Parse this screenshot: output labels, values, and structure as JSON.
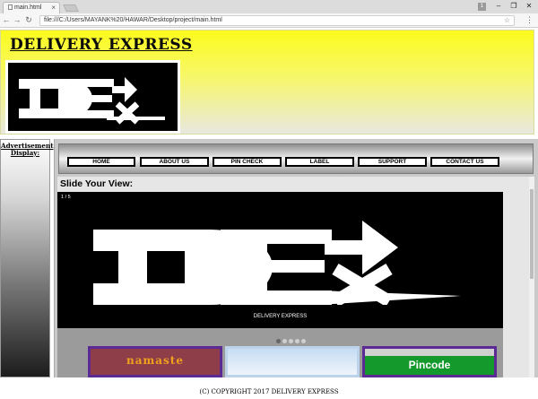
{
  "browser": {
    "tab_title": "main.html",
    "address": "file:///C:/Users/MAYANK%20/HAWAR/Desktop/project/main.html",
    "profile_label": "1"
  },
  "header": {
    "brand": "DELIVERY EXPRESS"
  },
  "sidebar": {
    "title": "Advertisement Display:"
  },
  "nav": {
    "items": [
      "HOME",
      "ABOUT US",
      "PIN CHECK",
      "LABEL",
      "SUPPORT",
      "CONTACT US"
    ]
  },
  "main": {
    "heading": "Slide Your View:",
    "slider": {
      "counter": "1 / 5",
      "caption": "DELIVERY EXPRESS",
      "total_slides": 5,
      "active_slide": 1
    },
    "thumbnails": [
      {
        "text": "namaste",
        "colors": {
          "bg": "#8e3e49",
          "text": "#f0a21c"
        }
      },
      {
        "text": ""
      },
      {
        "text": "Pincode",
        "colors": {
          "bg": "#149a2c",
          "text": "#ffffff"
        }
      }
    ]
  },
  "footer": {
    "text": "(C) COPYRIGHT 2017 DELIVERY EXPRESS"
  },
  "colors": {
    "header_yellow": "#fbfb1d",
    "thumb_border": "#5b2a95"
  }
}
